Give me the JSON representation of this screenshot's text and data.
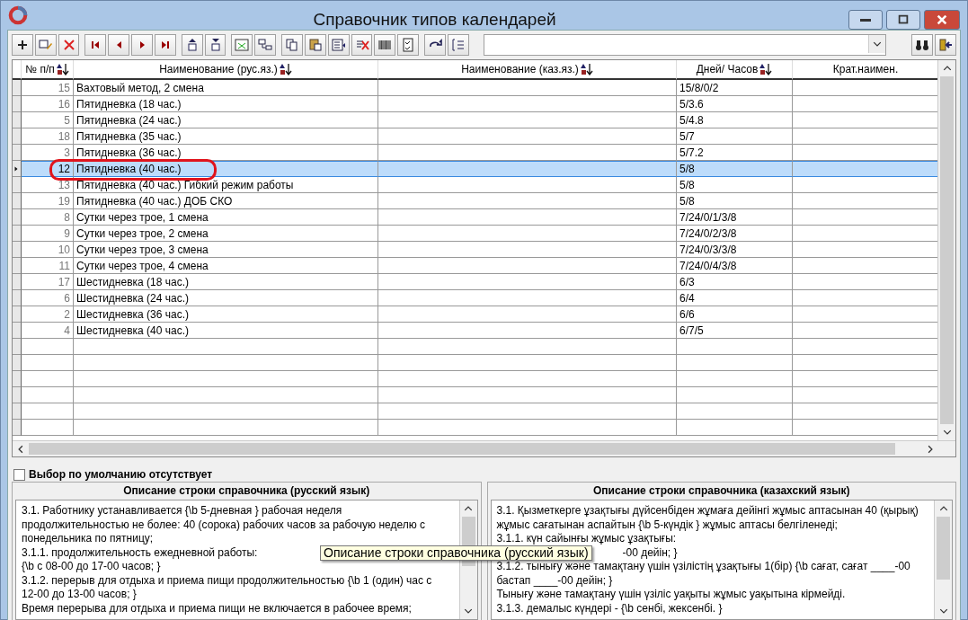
{
  "window": {
    "title": "Справочник типов календарей"
  },
  "table": {
    "columns": [
      {
        "label": "№ п/п",
        "sortable": true
      },
      {
        "label": "Наименование (рус.яз.)",
        "sortable": true
      },
      {
        "label": "Наименование (каз.яз.)",
        "sortable": true
      },
      {
        "label": "Дней/ Часов",
        "sortable": true
      },
      {
        "label": "Крат.наимен.",
        "sortable": false
      }
    ],
    "rows": [
      {
        "num": "15",
        "name_ru": "Вахтовый метод, 2 смена",
        "days": "15/8/0/2",
        "selected": false
      },
      {
        "num": "16",
        "name_ru": "Пятидневка (18 час.)",
        "days": "5/3.6",
        "selected": false
      },
      {
        "num": "5",
        "name_ru": "Пятидневка (24 час.)",
        "days": "5/4.8",
        "selected": false
      },
      {
        "num": "18",
        "name_ru": "Пятидневка (35 час.)",
        "days": "5/7",
        "selected": false
      },
      {
        "num": "3",
        "name_ru": "Пятидневка (36 час.)",
        "days": "5/7.2",
        "selected": false
      },
      {
        "num": "12",
        "name_ru": "Пятидневка (40 час.)",
        "days": "5/8",
        "selected": true
      },
      {
        "num": "13",
        "name_ru": "Пятидневка (40 час.) Гибкий режим работы",
        "days": "5/8",
        "selected": false
      },
      {
        "num": "19",
        "name_ru": "Пятидневка (40 час.) ДОБ СКО",
        "days": "5/8",
        "selected": false
      },
      {
        "num": "8",
        "name_ru": "Сутки через трое, 1 смена",
        "days": "7/24/0/1/3/8",
        "selected": false
      },
      {
        "num": "9",
        "name_ru": "Сутки через трое, 2 смена",
        "days": "7/24/0/2/3/8",
        "selected": false
      },
      {
        "num": "10",
        "name_ru": "Сутки через трое, 3 смена",
        "days": "7/24/0/3/3/8",
        "selected": false
      },
      {
        "num": "11",
        "name_ru": "Сутки через трое, 4 смена",
        "days": "7/24/0/4/3/8",
        "selected": false
      },
      {
        "num": "17",
        "name_ru": "Шестидневка (18 час.)",
        "days": "6/3",
        "selected": false
      },
      {
        "num": "6",
        "name_ru": "Шестидневка (24 час.)",
        "days": "6/4",
        "selected": false
      },
      {
        "num": "2",
        "name_ru": "Шестидневка (36 час.)",
        "days": "6/6",
        "selected": false
      },
      {
        "num": "4",
        "name_ru": "Шестидневка (40 час.)",
        "days": "6/7/5",
        "selected": false
      }
    ]
  },
  "default_choice": {
    "label": "Выбор по умолчанию отсутствует",
    "checked": false
  },
  "description_ru": {
    "title": "Описание строки справочника (русский язык)",
    "lines": [
      "3.1. Работнику устанавливается {\\b 5-дневная } рабочая неделя",
      "продолжительностью не более: 40 (сорока) рабочих часов за рабочую неделю с",
      "понедельника по пятницу;",
      "3.1.1. продолжительность ежедневной работы:",
      "{\\b с 08-00 до 17-00 часов; }",
      "3.1.2. перерыв для отдыха и приема пищи продолжительностью {\\b 1 (один) час с",
      "12-00 до 13-00 часов;  }",
      "Время перерыва для отдыха и приема пищи не включается в рабочее время;"
    ]
  },
  "description_kz": {
    "title": "Описание строки справочника (казахский язык)",
    "lines": [
      {
        "text": "3.1. Қызметкерге ұзақтығы дүйсенбіден жұмаға дейінгі жұмыс аптасынан 40 (қырық)",
        "covered": false
      },
      {
        "text": "жұмыс сағатынан аспайтын {\\b 5-күндік } жұмыс аптасы белгіленеді;",
        "covered": false
      },
      {
        "text": "3.1.1. күн сайынғы жұмыс ұзақтығы:",
        "covered": false
      },
      {
        "text": "-00 дейін; }",
        "covered": true
      },
      {
        "text": "3.1.2. тынығу және тамақтану үшін үзілістің ұзақтығы 1(бір) {\\b сағат, сағат ____-00",
        "covered": false
      },
      {
        "text": "бастап ____-00 дейін; }",
        "covered": false
      },
      {
        "text": "Тынығу және тамақтану үшін үзіліс уақыты жұмыс уақытына кірмейді.",
        "covered": false
      },
      {
        "text": "3.1.3. демалыс күндері - {\\b сенбі, жексенбі. }",
        "covered": false
      }
    ]
  },
  "tooltip": {
    "text": "Описание строки справочника (русский язык)"
  }
}
